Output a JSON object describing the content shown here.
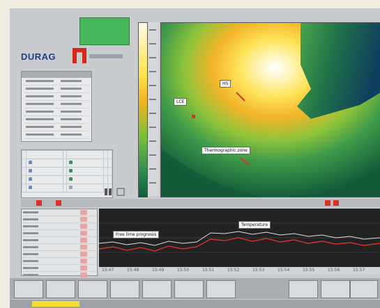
{
  "app": {
    "brand": "DURAG"
  },
  "thermal_view": {
    "labels": {
      "hot_spot": "HS",
      "lower_left": "LCE",
      "thermographic_zone": "Thermographic zone"
    }
  },
  "trend": {
    "labels": {
      "series_a": "Free lime prognosis",
      "series_b": "Temperature"
    },
    "time_ticks": [
      "15:47",
      "15:48",
      "15:49",
      "15:50",
      "15:51",
      "15:52",
      "15:53",
      "15:54",
      "15:55",
      "15:56",
      "15:57"
    ]
  },
  "colors": {
    "status_green": "#46b85b",
    "brand_blue": "#1b3f8f",
    "brand_red": "#d9261c",
    "alarm_red": "#d8322b",
    "status_yellow": "#f4e02c"
  }
}
